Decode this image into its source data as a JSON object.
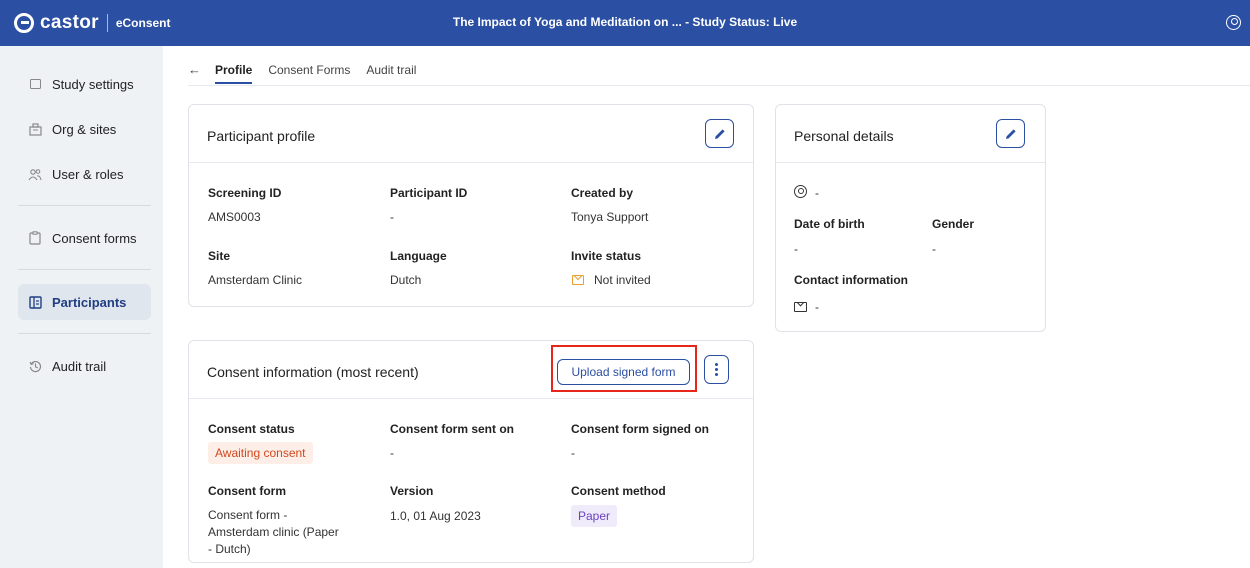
{
  "app": {
    "brand": "castor",
    "product": "eConsent",
    "title": "The Impact of Yoga and Meditation on ...  - Study Status: Live"
  },
  "sidebar": {
    "items": [
      {
        "label": "Study settings",
        "icon": "layout-icon"
      },
      {
        "label": "Org & sites",
        "icon": "building-icon"
      },
      {
        "label": "User & roles",
        "icon": "users-icon"
      },
      {
        "label": "Consent forms",
        "icon": "clipboard-icon"
      },
      {
        "label": "Participants",
        "icon": "participants-icon",
        "active": true
      },
      {
        "label": "Audit trail",
        "icon": "history-icon"
      }
    ]
  },
  "tabs": [
    {
      "label": "Profile",
      "active": true
    },
    {
      "label": "Consent Forms"
    },
    {
      "label": "Audit trail"
    }
  ],
  "participant_profile": {
    "title": "Participant profile",
    "screening_id_label": "Screening ID",
    "screening_id": "AMS0003",
    "participant_id_label": "Participant ID",
    "participant_id": "-",
    "created_by_label": "Created by",
    "created_by": "Tonya Support",
    "site_label": "Site",
    "site": "Amsterdam Clinic",
    "language_label": "Language",
    "language": "Dutch",
    "invite_status_label": "Invite status",
    "invite_status": "Not invited"
  },
  "personal_details": {
    "title": "Personal details",
    "name": "-",
    "dob_label": "Date of birth",
    "dob": "-",
    "gender_label": "Gender",
    "gender": "-",
    "contact_label": "Contact information",
    "email": "-"
  },
  "consent_info": {
    "title": "Consent information (most recent)",
    "upload_label": "Upload signed form",
    "status_label": "Consent status",
    "status": "Awaiting consent",
    "sent_on_label": "Consent form sent on",
    "sent_on": "-",
    "signed_on_label": "Consent form signed on",
    "signed_on": "-",
    "form_label": "Consent form",
    "form": "Consent form - Amsterdam clinic (Paper - Dutch)",
    "version_label": "Version",
    "version": "1.0, 01 Aug 2023",
    "method_label": "Consent method",
    "method": "Paper"
  },
  "colors": {
    "brand": "#2b4fa3",
    "highlight": "#e8251a",
    "awaiting": "#d2491f",
    "paper": "#6a42c2"
  }
}
